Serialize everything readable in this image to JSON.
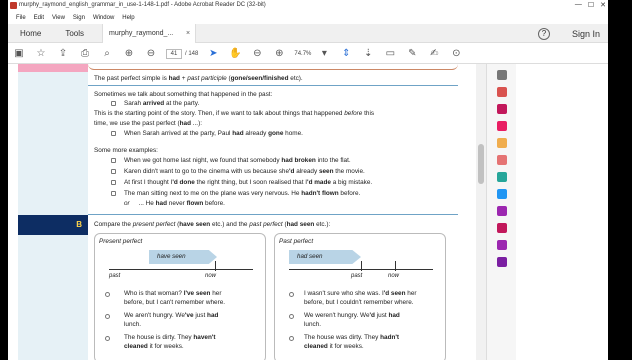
{
  "window": {
    "title": "murphy_raymond_english_grammar_in_use-1-148-1.pdf - Adobe Acrobat Reader DC (32-bit)",
    "controls": [
      "—",
      "☐",
      "✕"
    ]
  },
  "menu": [
    "File",
    "Edit",
    "View",
    "Sign",
    "Window",
    "Help"
  ],
  "tabs": {
    "home": "Home",
    "tools": "Tools",
    "doc": "murphy_raymond_...",
    "close": "×",
    "signin": "Sign In",
    "help": "?"
  },
  "toolbar": {
    "page_current": "41",
    "page_total": "/ 148",
    "zoom": "74.7%"
  },
  "content": {
    "intro": {
      "pre": "The past perfect simple is ",
      "b1": "had",
      "mid": " + ",
      "i1": "past participle",
      "post": " (",
      "b2": "gone/seen/finished",
      "end": " etc)."
    },
    "s1": "Sometimes we talk about something that happened in the past:",
    "ex1": {
      "pre": "Sarah ",
      "b": "arrived",
      "post": " at the party."
    },
    "s2a": {
      "pre": "This is the starting point of the story.  Then, if we want to talk about things that happened ",
      "i": "before",
      "post": " this"
    },
    "s2b": {
      "pre": "time, we use the past perfect (",
      "b": "had",
      "post": " ...):"
    },
    "ex2": {
      "pre": "When Sarah arrived at the party, Paul ",
      "b1": "had",
      "mid": " already ",
      "b2": "gone",
      "post": " home."
    },
    "s3": "Some more examples:",
    "ex3": {
      "pre": "When we got home last night, we found that somebody ",
      "b": "had broken",
      "post": " into the flat."
    },
    "ex4": {
      "pre": "Karen didn't want to go to the cinema with us because she",
      "b1": "'d",
      "mid": " already ",
      "b2": "seen",
      "post": " the movie."
    },
    "ex5": {
      "pre": "At first I thought I",
      "b1": "'d done",
      "mid": " the right thing, but I soon realised that I",
      "b2": "'d made",
      "post": " a big mistake."
    },
    "ex6": {
      "pre": "The man sitting next to me on the plane was very nervous.  He ",
      "b": "hadn't flown",
      "post": " before."
    },
    "ex6b": {
      "or": "or",
      "pre": "... He ",
      "b1": "had",
      "mid": " never ",
      "b2": "flown",
      "post": " before."
    },
    "section_b": "B",
    "compare": {
      "pre": "Compare the ",
      "i1": "present perfect",
      "m1": " (",
      "b1": "have seen",
      "m2": " etc.) and the ",
      "i2": "past perfect",
      "m3": " (",
      "b2": "had seen",
      "post": " etc.):"
    },
    "left": {
      "title": "Present perfect",
      "arrow": "have seen",
      "now": "now",
      "past": "past",
      "l1a": {
        "pre": "Who is that woman?  ",
        "b": "I've seen",
        "post": " her"
      },
      "l1b": "before, but I can't remember where.",
      "l2a": {
        "pre": "We aren't hungry.  We",
        "b": "'ve",
        "mid": " just ",
        "b2": "had"
      },
      "l2b": "lunch.",
      "l3a": {
        "pre": "The house is dirty.  They ",
        "b": "haven't"
      },
      "l3b": {
        "b": "cleaned",
        "post": " it for weeks."
      }
    },
    "right": {
      "title": "Past perfect",
      "arrow": "had seen",
      "now": "now",
      "past": "past",
      "r1a": {
        "pre": "I wasn't sure who she was.  I",
        "b": "'d seen",
        "post": " her"
      },
      "r1b": "before, but I couldn't remember where.",
      "r2a": {
        "pre": "We weren't hungry.  We",
        "b": "'d",
        "mid": " just ",
        "b2": "had"
      },
      "r2b": "lunch.",
      "r3a": {
        "pre": "The house was dirty.  They ",
        "b": "hadn't"
      },
      "r3b": {
        "b": "cleaned",
        "post": " it for weeks."
      }
    }
  }
}
